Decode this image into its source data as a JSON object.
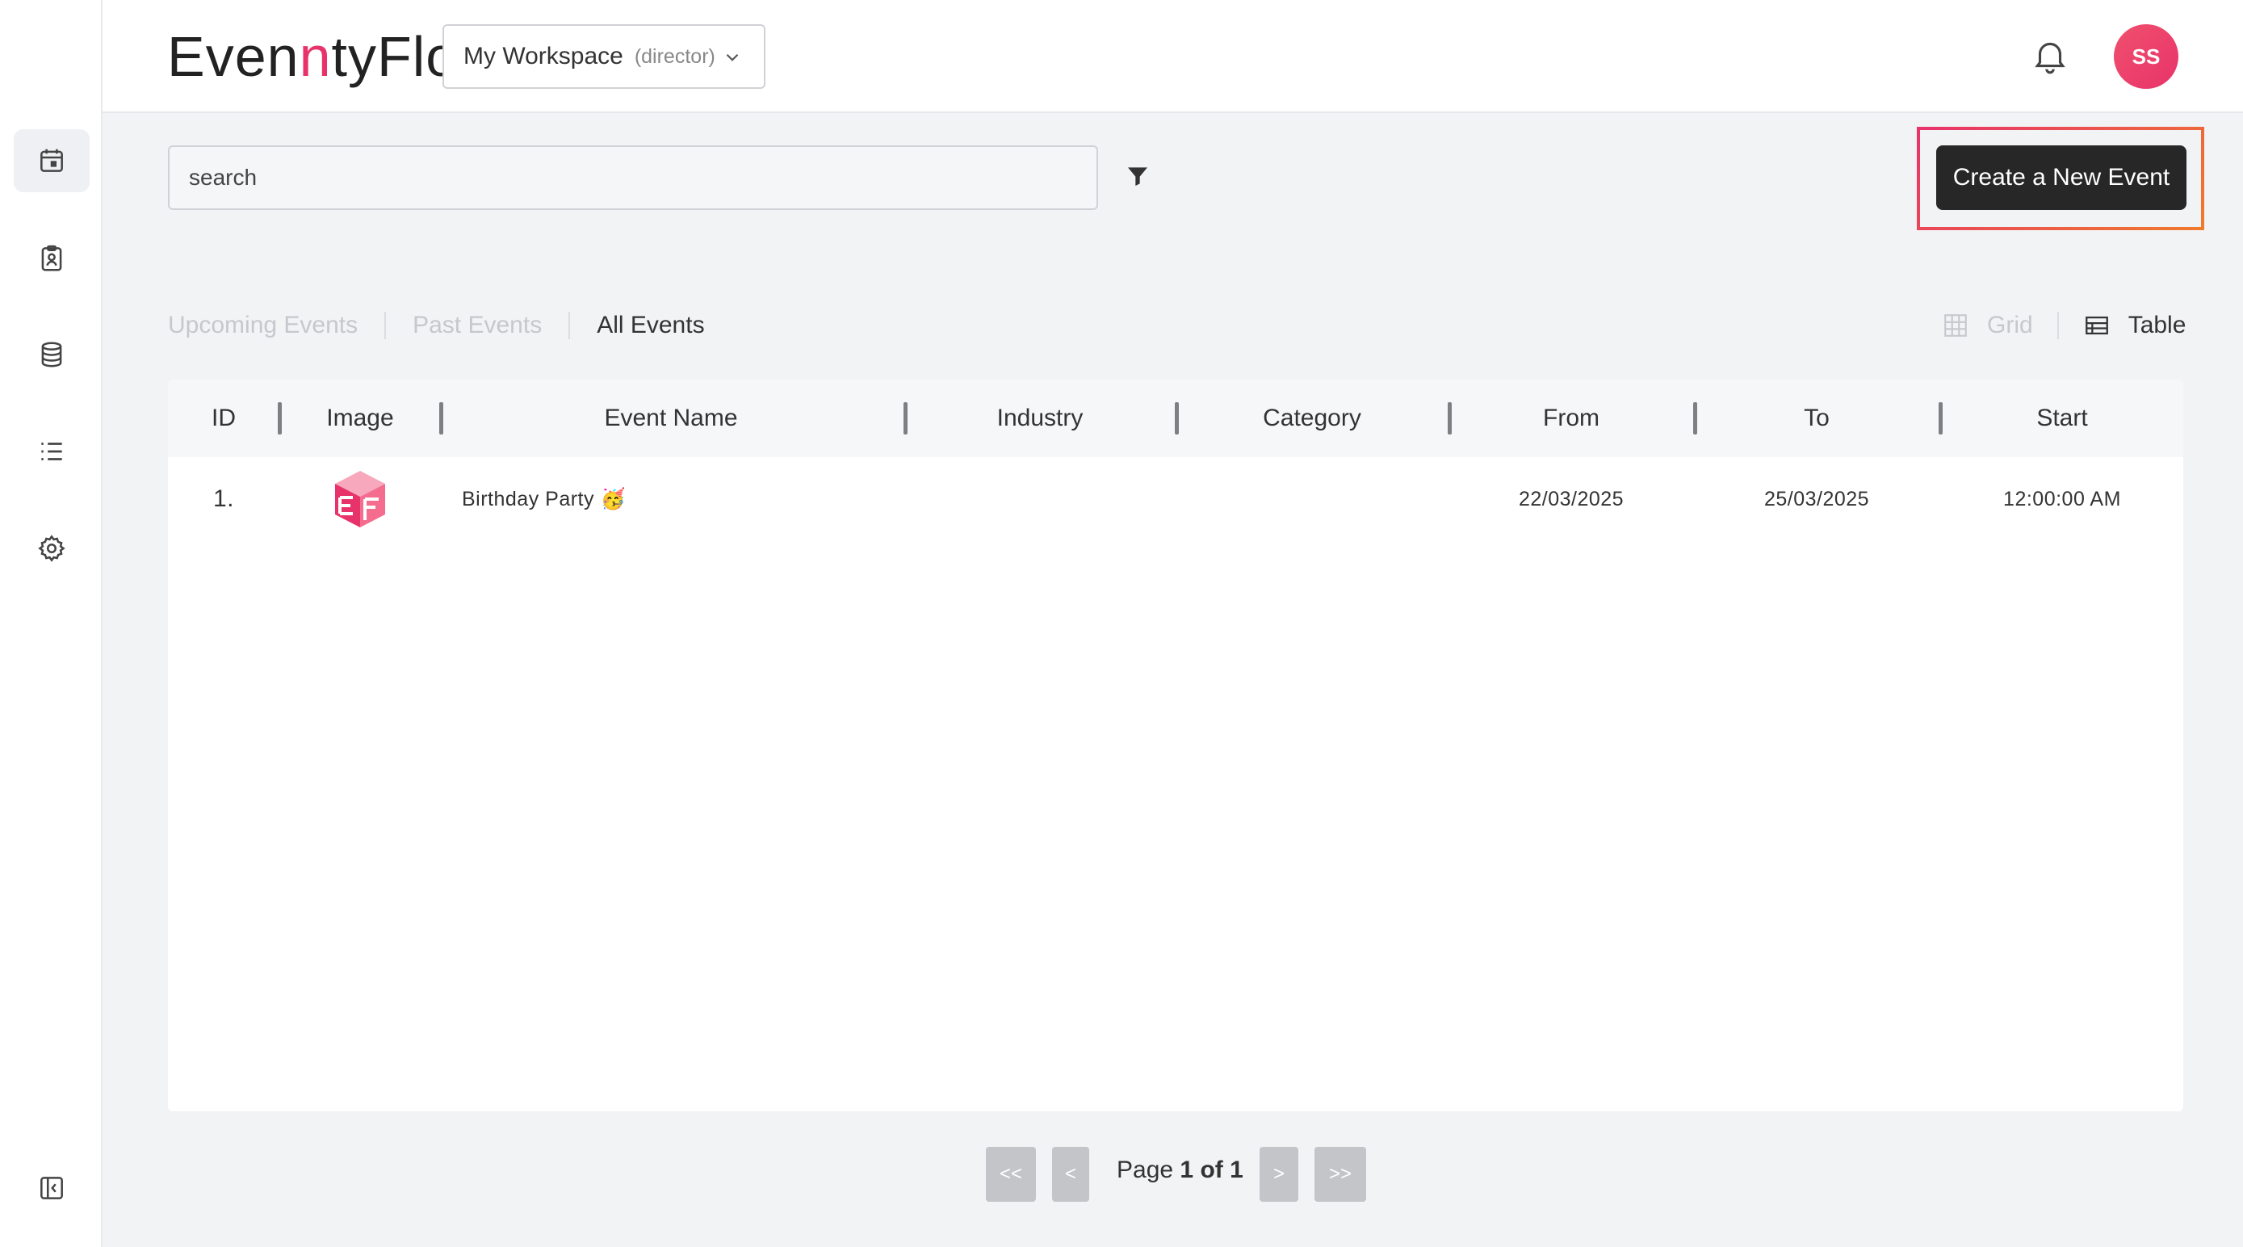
{
  "app": {
    "logo_pre": "Even",
    "logo_accent": "n",
    "logo_post": "tyFlo",
    "workspace_name": "My Workspace",
    "workspace_role": "(director)",
    "avatar_initials": "SS",
    "accent_color": "#e8336a"
  },
  "sidebar": {
    "items": [
      {
        "icon": "calendar-icon",
        "active": true
      },
      {
        "icon": "id-badge-icon",
        "active": false
      },
      {
        "icon": "database-icon",
        "active": false
      },
      {
        "icon": "list-icon",
        "active": false
      },
      {
        "icon": "gear-icon",
        "active": false
      }
    ],
    "footer_icon": "collapse-sidebar-icon"
  },
  "toolbar": {
    "search_placeholder": "search",
    "create_label": "Create a New Event"
  },
  "tabs": [
    {
      "label": "Upcoming Events",
      "active": false
    },
    {
      "label": "Past Events",
      "active": false
    },
    {
      "label": "All Events",
      "active": true
    }
  ],
  "views": {
    "grid_label": "Grid",
    "table_label": "Table",
    "selected": "Table"
  },
  "table": {
    "columns": [
      "ID",
      "Image",
      "Event Name",
      "Industry",
      "Category",
      "From",
      "To",
      "Start"
    ],
    "rows": [
      {
        "id": "1.",
        "image": "event-logo",
        "event_name": "Birthday Party 🥳",
        "industry": "",
        "category": "",
        "from": "22/03/2025",
        "to": "25/03/2025",
        "start": "12:00:00 AM"
      }
    ]
  },
  "pagination": {
    "first": "<<",
    "prev": "<",
    "next": ">",
    "last": ">>",
    "page_prefix": "Page",
    "current": "1",
    "of": "of",
    "total": "1"
  }
}
